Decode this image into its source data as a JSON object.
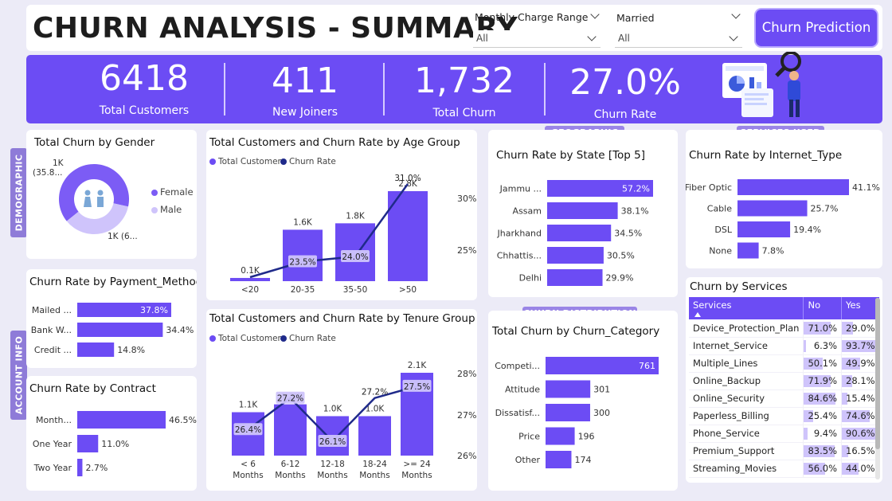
{
  "title": "CHURN ANALYSIS - SUMMARY",
  "filters": {
    "monthly": {
      "label": "Monthly Charge Range",
      "value": "All"
    },
    "married": {
      "label": "Married",
      "value": "All"
    }
  },
  "predict_button": "Churn Prediction",
  "kpis": [
    {
      "value": "6418",
      "label": "Total Customers"
    },
    {
      "value": "411",
      "label": "New Joiners"
    },
    {
      "value": "1,732",
      "label": "Total Churn"
    },
    {
      "value": "27.0%",
      "label": "Churn Rate"
    }
  ],
  "section_tags": {
    "demographic": "DEMOGRAPHIC",
    "account": "ACCOUNT INFO",
    "geographic": "GEOGRAPHIC",
    "services_used": "SERVICES USED",
    "churn_distribution": "CHURN DISTRIBUTION"
  },
  "gender": {
    "title": "Total Churn by Gender",
    "label_top_line1": "1K",
    "label_top_line2": "(35.8...",
    "label_bottom": "1K (6...",
    "legend_female": "Female",
    "legend_male": "Male"
  },
  "age": {
    "title": "Total Customers and Churn Rate by Age Group",
    "legend_customers": "Total Customers",
    "legend_rate": "Churn Rate",
    "y_ticks": [
      "30%",
      "25%"
    ]
  },
  "tenure": {
    "title": "Total Customers and Churn Rate by Tenure Group",
    "legend_customers": "Total Customers",
    "legend_rate": "Churn Rate",
    "y_ticks": [
      "28%",
      "27%",
      "26%"
    ]
  },
  "payment": {
    "title": "Churn Rate by Payment_Method"
  },
  "contract": {
    "title": "Churn Rate by Contract"
  },
  "state": {
    "title": "Churn Rate by State [Top 5]"
  },
  "category": {
    "title": "Total Churn by Churn_Category"
  },
  "internet": {
    "title": "Churn Rate by Internet_Type"
  },
  "services": {
    "title": "Churn by Services",
    "headers": [
      "Services",
      "No",
      "Yes"
    ],
    "rows": [
      {
        "name": "Device_Protection_Plan",
        "no": "71.0%",
        "yes": "29.0%",
        "no_v": 71.0,
        "yes_v": 29.0
      },
      {
        "name": "Internet_Service",
        "no": "6.3%",
        "yes": "93.7%",
        "no_v": 6.3,
        "yes_v": 93.7
      },
      {
        "name": "Multiple_Lines",
        "no": "50.1%",
        "yes": "49.9%",
        "no_v": 50.1,
        "yes_v": 49.9
      },
      {
        "name": "Online_Backup",
        "no": "71.9%",
        "yes": "28.1%",
        "no_v": 71.9,
        "yes_v": 28.1
      },
      {
        "name": "Online_Security",
        "no": "84.6%",
        "yes": "15.4%",
        "no_v": 84.6,
        "yes_v": 15.4
      },
      {
        "name": "Paperless_Billing",
        "no": "25.4%",
        "yes": "74.6%",
        "no_v": 25.4,
        "yes_v": 74.6
      },
      {
        "name": "Phone_Service",
        "no": "9.4%",
        "yes": "90.6%",
        "no_v": 9.4,
        "yes_v": 90.6
      },
      {
        "name": "Premium_Support",
        "no": "83.5%",
        "yes": "16.5%",
        "no_v": 83.5,
        "yes_v": 16.5
      },
      {
        "name": "Streaming_Movies",
        "no": "56.0%",
        "yes": "44.0%",
        "no_v": 56.0,
        "yes_v": 44.0
      }
    ]
  },
  "colors": {
    "accent": "#6c4cf4",
    "line": "#1f2a8a",
    "light": "#cfc4fb"
  },
  "chart_data": [
    {
      "type": "pie",
      "chart": "gender",
      "categories": [
        "Female",
        "Male"
      ],
      "values": [
        64.2,
        35.8
      ]
    },
    {
      "type": "bar",
      "chart": "age",
      "categories": [
        "<20",
        "20-35",
        "35-50",
        ">50"
      ],
      "series": [
        {
          "name": "Total Customers",
          "values": [
            0.1,
            1.6,
            1.8,
            2.8
          ],
          "labels": [
            "0.1K",
            "1.6K",
            "1.8K",
            "2.8K"
          ]
        },
        {
          "name": "Churn Rate",
          "values": [
            22.0,
            23.5,
            24.0,
            31.0
          ],
          "labels": [
            "",
            "23.5%",
            "24.0%",
            "31.0%"
          ]
        }
      ]
    },
    {
      "type": "bar",
      "chart": "tenure",
      "categories": [
        "< 6 Months",
        "6-12 Months",
        "12-18 Months",
        "18-24 Months",
        ">= 24 Months"
      ],
      "series": [
        {
          "name": "Total Customers",
          "values": [
            1.1,
            1.3,
            1.0,
            1.0,
            2.1
          ],
          "labels": [
            "1.1K",
            "1.3K",
            "1.0K",
            "1.0K",
            "2.1K"
          ]
        },
        {
          "name": "Churn Rate",
          "values": [
            26.4,
            27.2,
            26.1,
            27.2,
            27.5
          ],
          "labels": [
            "26.4%",
            "27.2%",
            "26.1%",
            "27.2%",
            "27.5%"
          ]
        }
      ]
    },
    {
      "type": "bar",
      "chart": "payment",
      "categories": [
        "Mailed ...",
        "Bank W...",
        "Credit ..."
      ],
      "values": [
        37.8,
        34.4,
        14.8
      ],
      "labels": [
        "37.8%",
        "34.4%",
        "14.8%"
      ]
    },
    {
      "type": "bar",
      "chart": "contract",
      "categories": [
        "Month...",
        "One Year",
        "Two Year"
      ],
      "values": [
        46.5,
        11.0,
        2.7
      ],
      "labels": [
        "46.5%",
        "11.0%",
        "2.7%"
      ]
    },
    {
      "type": "bar",
      "chart": "state",
      "categories": [
        "Jammu ...",
        "Assam",
        "Jharkhand",
        "Chhattis...",
        "Delhi"
      ],
      "values": [
        57.2,
        38.1,
        34.5,
        30.5,
        29.9
      ],
      "labels": [
        "57.2%",
        "38.1%",
        "34.5%",
        "30.5%",
        "29.9%"
      ]
    },
    {
      "type": "bar",
      "chart": "category",
      "categories": [
        "Competi...",
        "Attitude",
        "Dissatisf...",
        "Price",
        "Other"
      ],
      "values": [
        761,
        301,
        300,
        196,
        174
      ],
      "labels": [
        "761",
        "301",
        "300",
        "196",
        "174"
      ]
    },
    {
      "type": "bar",
      "chart": "internet",
      "categories": [
        "Fiber Optic",
        "Cable",
        "DSL",
        "None"
      ],
      "values": [
        41.1,
        25.7,
        19.4,
        7.8
      ],
      "labels": [
        "41.1%",
        "25.7%",
        "19.4%",
        "7.8%"
      ]
    }
  ]
}
